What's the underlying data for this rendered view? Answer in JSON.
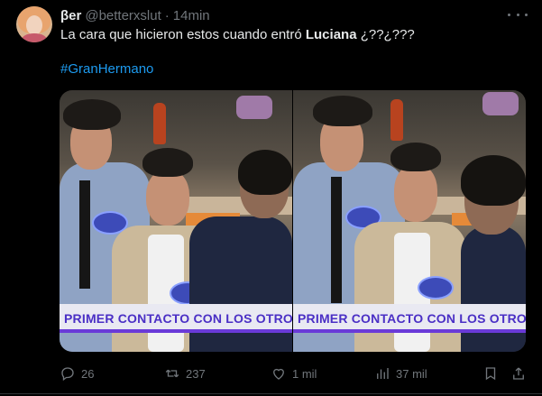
{
  "tweet": {
    "display_name": "βer",
    "handle": "@betterxslut",
    "separator": "·",
    "time": "14min",
    "text_before": "La cara que hicieron estos cuando entró ",
    "text_bold": "Luciana",
    "text_after": " ¿??¿???",
    "hashtag": "#GranHermano"
  },
  "media": {
    "panels": [
      {
        "banner_text": "PRIMER CONTACTO CON LOS OTROS JUGADO"
      },
      {
        "banner_text": "PRIMER CONTACTO CON LOS OTROS JUGA"
      }
    ]
  },
  "actions": {
    "reply_count": "26",
    "retweet_count": "237",
    "like_count": "1 mil",
    "views_count": "37 mil"
  },
  "icons": {
    "reply": "reply-icon",
    "retweet": "retweet-icon",
    "like": "heart-icon",
    "views": "views-icon",
    "bookmark": "bookmark-icon",
    "share": "share-icon",
    "more": "more-icon"
  },
  "colors": {
    "background": "#000000",
    "text": "#e7e9ea",
    "muted": "#71767b",
    "link": "#1d9bf0",
    "banner_text": "#4a2fc5"
  }
}
